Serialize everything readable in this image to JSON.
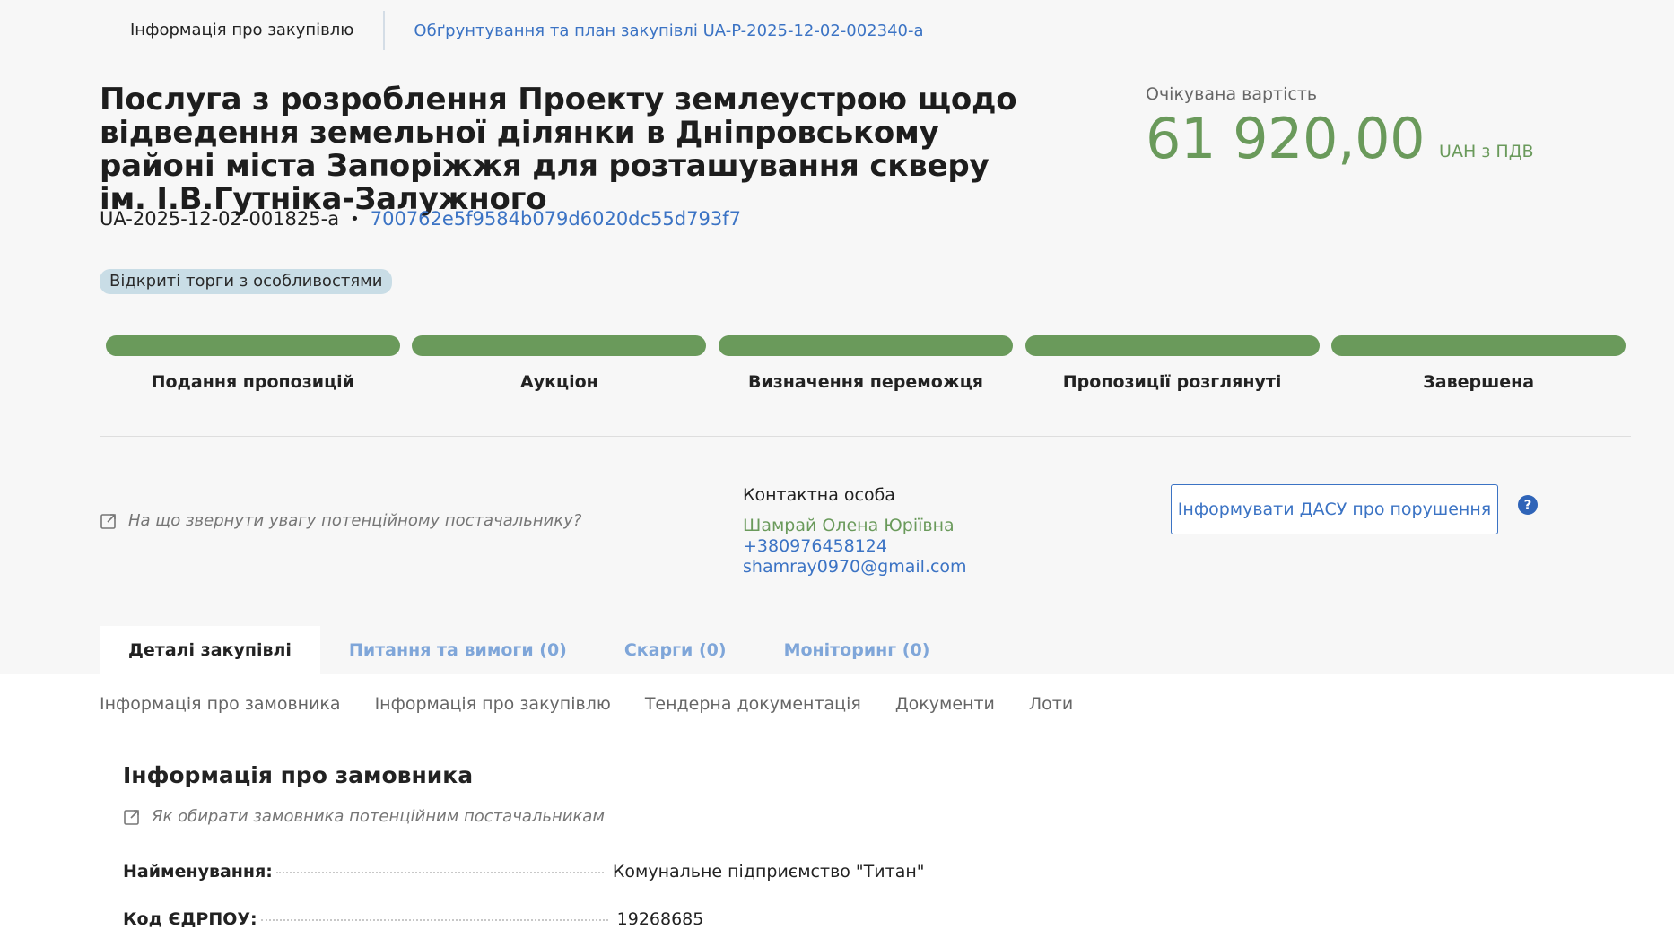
{
  "top_nav": {
    "active": "Інформація про закупівлю",
    "link": "Обґрунтування та план закупівлі UA-P-2025-12-02-002340-a"
  },
  "tender": {
    "title": "Послуга з розроблення Проекту землеустрою щодо відведення земельної ділянки в Дніпровському районі міста Запоріжжя для розташування скверу ім. І.В.Гутніка-Залужного",
    "id": "UA-2025-12-02-001825-a",
    "hash": "700762e5f9584b079d6020dc55d793f7",
    "badge": "Відкриті торги з особливостями"
  },
  "value": {
    "label": "Очікувана вартість",
    "amount": "61 920,00",
    "currency": "UAH з ПДВ"
  },
  "stages": [
    {
      "label": "Подання пропозицій"
    },
    {
      "label": "Аукціон"
    },
    {
      "label": "Визначення переможця"
    },
    {
      "label": "Пропозиції розглянуті"
    },
    {
      "label": "Завершена"
    }
  ],
  "hint": "На що звернути увагу потенційному постачальнику?",
  "contact": {
    "heading": "Контактна особа",
    "name": "Шамрай Олена Юріївна",
    "phone": "+380976458124",
    "email": "shamray0970@gmail.com"
  },
  "report_button": "Інформувати ДАСУ про порушення",
  "help_glyph": "?",
  "tabs": [
    {
      "label": "Деталі закупівлі"
    },
    {
      "label": "Питання та вимоги (0)"
    },
    {
      "label": "Скарги (0)"
    },
    {
      "label": "Моніторинг (0)"
    }
  ],
  "subnav": [
    "Інформація про замовника",
    "Інформація про закупівлю",
    "Тендерна документація",
    "Документи",
    "Лоти"
  ],
  "customer_section": {
    "title": "Інформація про замовника",
    "hint": "Як обирати замовника потенційним постачальникам",
    "rows": [
      {
        "label": "Найменування:",
        "value": "Комунальне підприємство \"Титан\""
      },
      {
        "label": "Код ЄДРПОУ:",
        "value": "19268685"
      }
    ]
  },
  "colors": {
    "accent_blue": "#3b73c4",
    "green": "#6a9a5b",
    "badge_bg": "#c9dde6"
  },
  "icons": [
    "external-link-icon",
    "help-icon"
  ]
}
